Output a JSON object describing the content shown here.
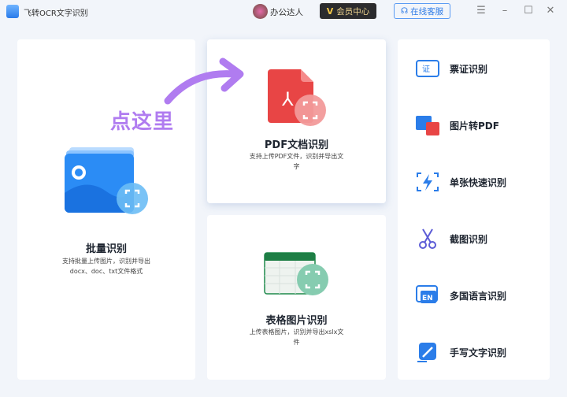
{
  "app": {
    "title": "飞转OCR文字识别",
    "username": "办公达人",
    "vip_label": "会员中心",
    "vip_icon": "V",
    "service_label": "在线客服"
  },
  "window": {
    "menu": "☰",
    "minimize": "–",
    "maximize": "☐",
    "close": "✕"
  },
  "hint": "点这里",
  "features": {
    "batch": {
      "title": "批量识别",
      "desc": "支持批量上传图片，识别并导出docx、doc、txt文件格式"
    },
    "pdf": {
      "title": "PDF文档识别",
      "desc": "支持上传PDF文件，识别并导出文字"
    },
    "table": {
      "title": "表格图片识别",
      "desc": "上传表格图片，识别并导出xslx文件"
    }
  },
  "side_items": [
    {
      "label": "票证识别",
      "icon": "证"
    },
    {
      "label": "图片转PDF",
      "icon": "pdf"
    },
    {
      "label": "单张快速识别",
      "icon": "flash"
    },
    {
      "label": "截图识别",
      "icon": "scissors"
    },
    {
      "label": "多国语言识别",
      "icon": "EN"
    },
    {
      "label": "手写文字识别",
      "icon": "pen"
    }
  ]
}
